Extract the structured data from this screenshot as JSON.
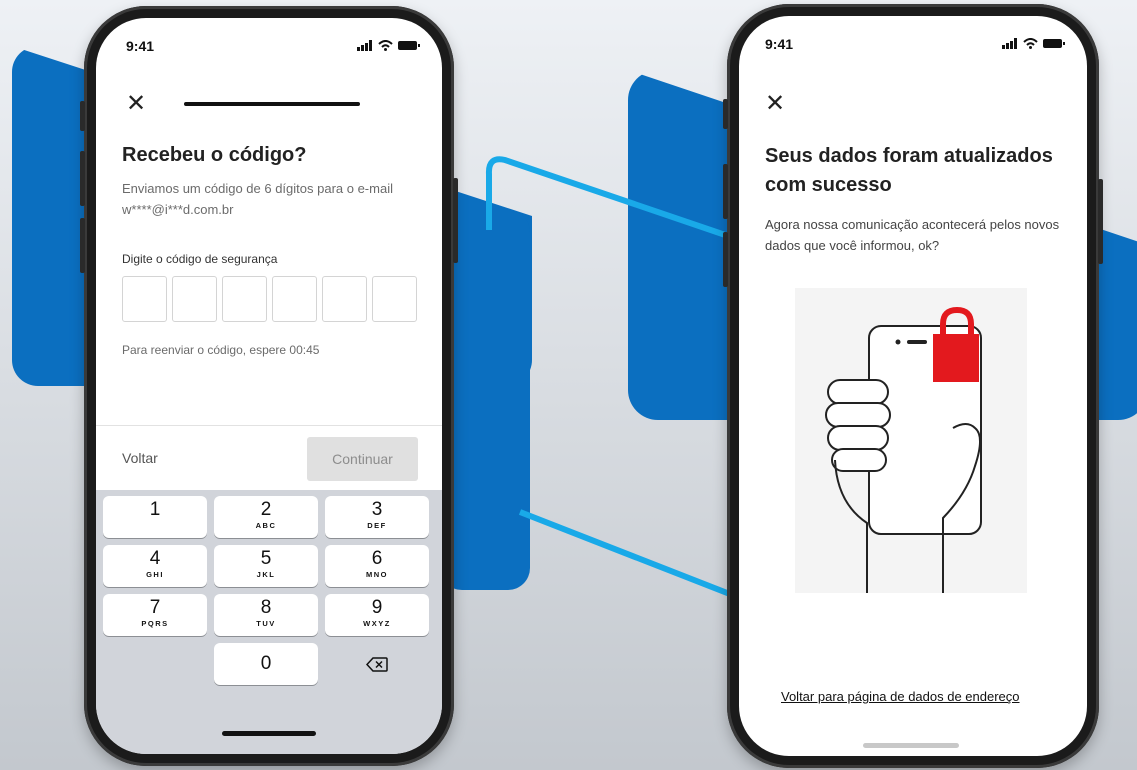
{
  "left_screen": {
    "status_time": "9:41",
    "title": "Recebeu o código?",
    "description": "Enviamos um código de 6 dígitos para o e-mail w****@i***d.com.br",
    "code_label": "Digite o código de segurança",
    "resend_text": "Para reenviar o código, espere 00:45",
    "back_label": "Voltar",
    "continue_label": "Continuar",
    "keypad": [
      {
        "num": "1",
        "letters": ""
      },
      {
        "num": "2",
        "letters": "ABC"
      },
      {
        "num": "3",
        "letters": "DEF"
      },
      {
        "num": "4",
        "letters": "GHI"
      },
      {
        "num": "5",
        "letters": "JKL"
      },
      {
        "num": "6",
        "letters": "MNO"
      },
      {
        "num": "7",
        "letters": "PQRS"
      },
      {
        "num": "8",
        "letters": "TUV"
      },
      {
        "num": "9",
        "letters": "WXYZ"
      },
      {
        "num": "0",
        "letters": ""
      }
    ]
  },
  "right_screen": {
    "status_time": "9:41",
    "title": "Seus dados foram atualizados com sucesso",
    "description": "Agora nossa comunicação acontecerá pelos novos dados que você informou, ok?",
    "link_label": "Voltar para página de dados de endereço"
  },
  "colors": {
    "accent_blue": "#0b6fc0",
    "line_cyan": "#19a9e8",
    "lock_red": "#e3191e"
  }
}
